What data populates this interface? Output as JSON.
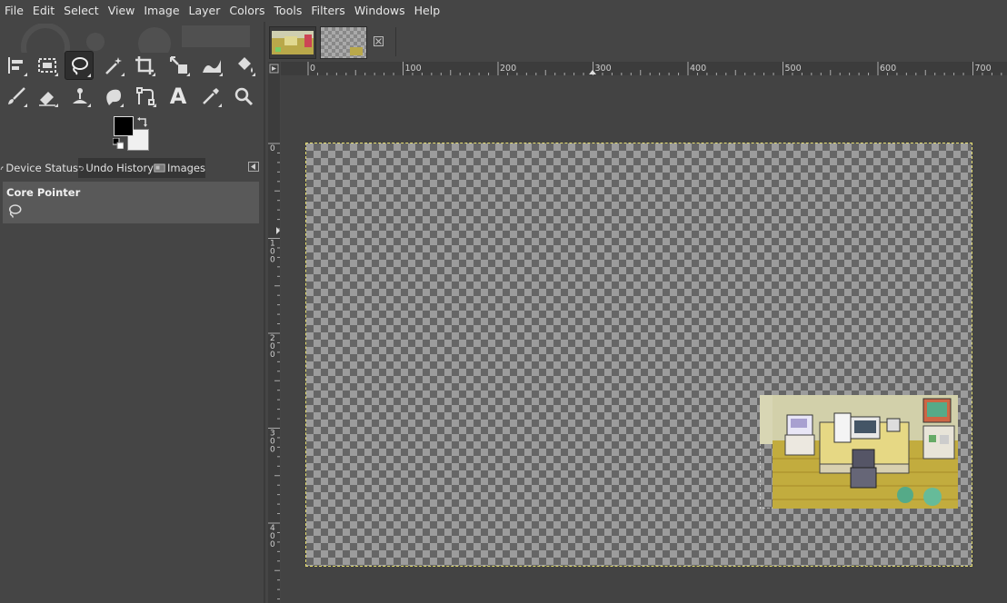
{
  "menubar": {
    "items": [
      "File",
      "Edit",
      "Select",
      "View",
      "Image",
      "Layer",
      "Colors",
      "Tools",
      "Filters",
      "Windows",
      "Help"
    ]
  },
  "toolbox": {
    "tools": [
      {
        "name": "align-icon",
        "active": false
      },
      {
        "name": "rect-select-icon",
        "active": false
      },
      {
        "name": "free-select-lasso-icon",
        "active": true
      },
      {
        "name": "fuzzy-select-wand-icon",
        "active": false
      },
      {
        "name": "crop-icon",
        "active": false
      },
      {
        "name": "unified-transform-icon",
        "active": false
      },
      {
        "name": "warp-transform-icon",
        "active": false
      },
      {
        "name": "bucket-fill-icon",
        "active": false
      },
      {
        "name": "paintbrush-icon",
        "active": false
      },
      {
        "name": "eraser-icon",
        "active": false
      },
      {
        "name": "clone-icon",
        "active": false
      },
      {
        "name": "smudge-icon",
        "active": false
      },
      {
        "name": "paths-icon",
        "active": false
      },
      {
        "name": "text-icon",
        "active": false
      },
      {
        "name": "color-picker-icon",
        "active": false
      },
      {
        "name": "zoom-icon",
        "active": false
      }
    ],
    "text_tool_glyph": "A",
    "foreground_color": "#000000",
    "background_color": "#f0f0f0"
  },
  "dock": {
    "tabs": [
      {
        "label": "Device Status",
        "icon": "device-status-icon"
      },
      {
        "label": "Undo History",
        "icon": "undo-history-icon"
      },
      {
        "label": "Images",
        "icon": "images-icon"
      }
    ],
    "device_status": {
      "title": "Core Pointer",
      "tool_icon": "free-select-lasso-icon"
    }
  },
  "image_tabs": {
    "count": 2,
    "close_icon": "close-icon"
  },
  "rulers": {
    "horizontal_labels": [
      "0",
      "100",
      "200",
      "300",
      "400",
      "500",
      "600",
      "700"
    ],
    "vertical_labels": [
      "0",
      "100",
      "200",
      "300",
      "400"
    ]
  },
  "colors": {
    "ui_bg": "#454545",
    "canvas_bg": "#434343",
    "selection_marquee": "#e8e070"
  }
}
